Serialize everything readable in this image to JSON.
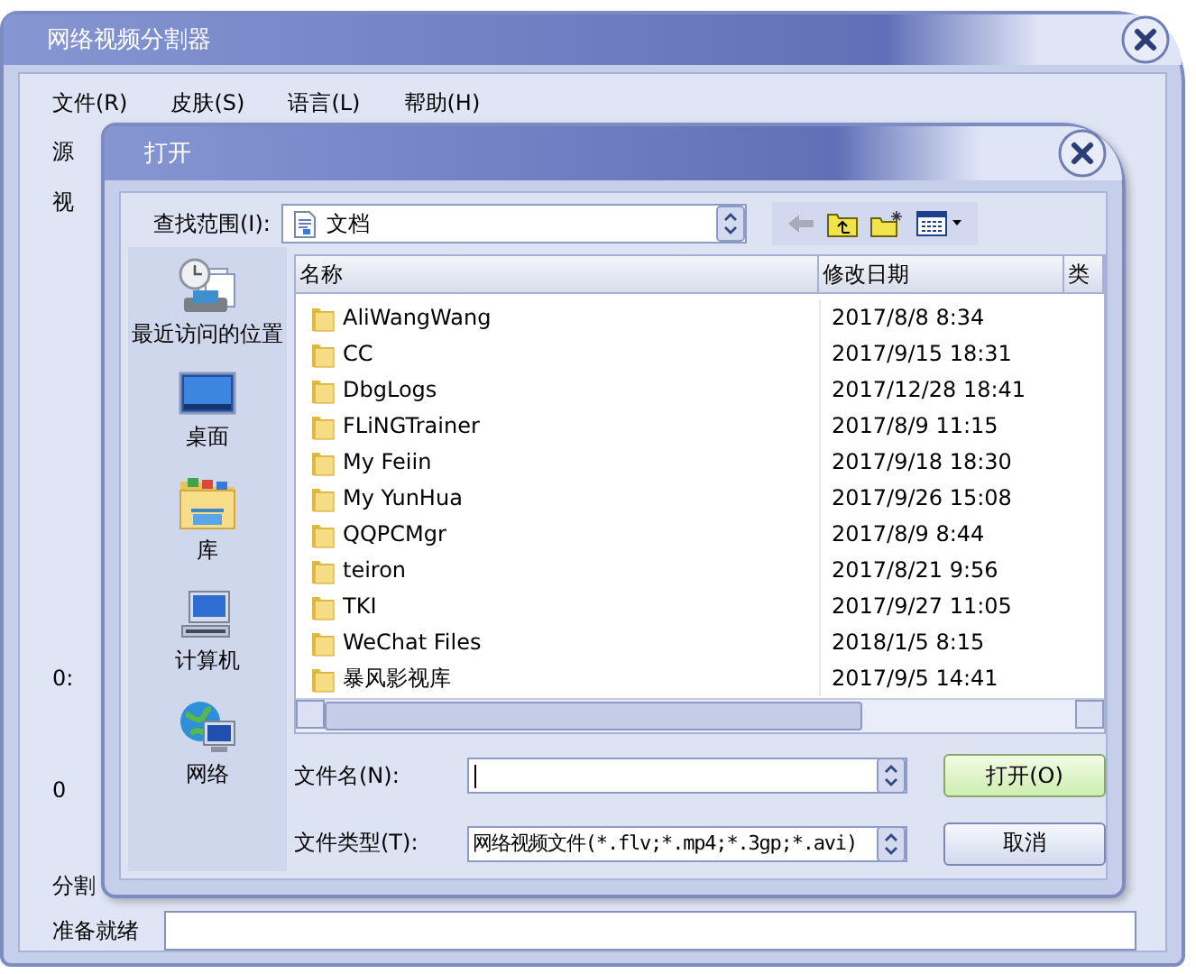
{
  "main_window": {
    "title": "网络视频分割器",
    "menu": [
      "文件(R)",
      "皮肤(S)",
      "语言(L)",
      "帮助(H)"
    ],
    "side_texts": [
      "源",
      "视",
      "0:",
      "0",
      "分割"
    ],
    "status": "准备就绪"
  },
  "dialog": {
    "title": "打开",
    "look_in_label": "查找范围(I):",
    "look_in_value": "文档",
    "places": [
      {
        "label": "最近访问的位置",
        "kind": "recent"
      },
      {
        "label": "桌面",
        "kind": "desktop"
      },
      {
        "label": "库",
        "kind": "library"
      },
      {
        "label": "计算机",
        "kind": "computer"
      },
      {
        "label": "网络",
        "kind": "network"
      }
    ],
    "columns": [
      "名称",
      "修改日期",
      "类"
    ],
    "rows": [
      {
        "name": "AliWangWang",
        "date": "2017/8/8 8:34"
      },
      {
        "name": "CC",
        "date": "2017/9/15 18:31"
      },
      {
        "name": "DbgLogs",
        "date": "2017/12/28 18:41"
      },
      {
        "name": "FLiNGTrainer",
        "date": "2017/8/9 11:15"
      },
      {
        "name": "My Feiin",
        "date": "2017/9/18 18:30"
      },
      {
        "name": "My YunHua",
        "date": "2017/9/26 15:08"
      },
      {
        "name": "QQPCMgr",
        "date": "2017/8/9 8:44"
      },
      {
        "name": "teiron",
        "date": "2017/8/21 9:56"
      },
      {
        "name": "TKI",
        "date": "2017/9/27 11:05"
      },
      {
        "name": "WeChat Files",
        "date": "2018/1/5 8:15"
      },
      {
        "name": "暴风影视库",
        "date": "2017/9/5 14:41"
      }
    ],
    "file_name_label": "文件名(N):",
    "file_type_label": "文件类型(T):",
    "file_type_value": "网络视频文件(*.flv;*.mp4;*.3gp;*.avi)",
    "buttons": [
      {
        "label": "打开(O)",
        "default": true
      },
      {
        "label": "取消",
        "default": false
      }
    ]
  }
}
